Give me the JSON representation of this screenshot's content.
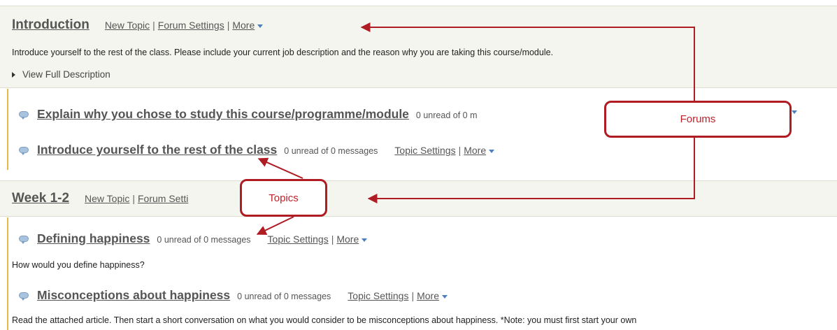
{
  "forums": [
    {
      "title": "Introduction",
      "new_topic": "New Topic",
      "forum_settings": "Forum Settings",
      "more": "More",
      "description": "Introduce yourself to the rest of the class. Please include your current job description and the reason why you are taking this course/module.",
      "view_full": "View Full Description",
      "topics": [
        {
          "title": "Explain why you chose to study this course/programme/module",
          "count": "0 unread of 0 m",
          "more_visible": ""
        },
        {
          "title": "Introduce yourself to the rest of the class",
          "count": "0 unread of 0 messages",
          "settings": "Topic Settings",
          "more": "More"
        }
      ]
    },
    {
      "title": "Week 1-2",
      "new_topic": "New Topic",
      "forum_settings": "Forum Setti",
      "topics": [
        {
          "title": "Defining happiness",
          "count": "0 unread of 0 messages",
          "settings": "Topic Settings",
          "more": "More",
          "description": "How would you define happiness?"
        },
        {
          "title": "Misconceptions about happiness",
          "count": "0 unread of 0 messages",
          "settings": "Topic Settings",
          "more": "More",
          "description": "Read the attached article. Then start a short conversation on what you would consider to be misconceptions about happiness. *Note: you must first start your own"
        }
      ]
    }
  ],
  "annotations": {
    "forums_label": "Forums",
    "topics_label": "Topics",
    "color": "#c0202a"
  }
}
